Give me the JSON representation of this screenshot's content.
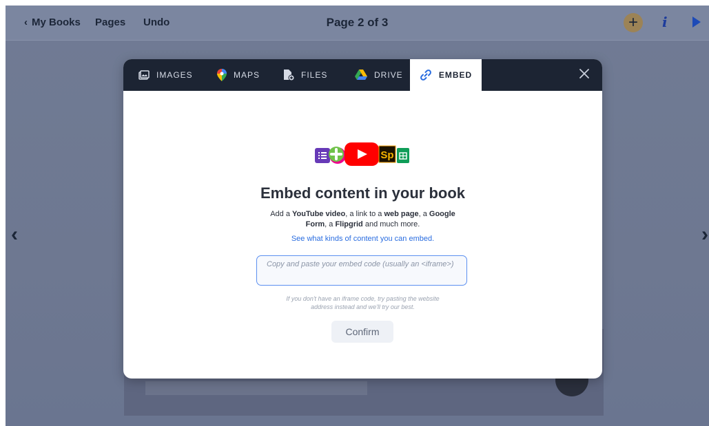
{
  "topbar": {
    "back_label": "My Books",
    "pages_label": "Pages",
    "undo_label": "Undo",
    "page_indicator": "Page 2 of 3"
  },
  "tabs": {
    "images": "IMAGES",
    "maps": "MAPS",
    "files": "FILES",
    "drive": "DRIVE",
    "embed": "EMBED"
  },
  "embed": {
    "headline": "Embed content in your book",
    "desc_part1": "Add a ",
    "desc_youtube": "YouTube video",
    "desc_part2": ", a link to a ",
    "desc_webpage": "web page",
    "desc_part3": ", a ",
    "desc_google": "Google",
    "desc_form": "Form",
    "desc_part4": ", a ",
    "desc_flipgrid": "Flipgrid",
    "desc_part5": " and much more.",
    "link_text": "See what kinds of content you can embed.",
    "input_placeholder": "Copy and paste your embed code (usually an <iframe>)",
    "hint_line1": "If you don't have an iframe code, try pasting the website",
    "hint_line2": "address instead and we'll try our best.",
    "confirm_label": "Confirm",
    "sp_label": "Sp"
  },
  "icons": {
    "back": "chevron-left-icon",
    "add": "plus-icon",
    "info": "info-icon",
    "play": "play-icon",
    "close": "close-icon"
  },
  "colors": {
    "tabbar": "#1c2433",
    "link": "#2a6de0",
    "input_border": "#5b8ff0",
    "add_button": "#9c8356"
  }
}
